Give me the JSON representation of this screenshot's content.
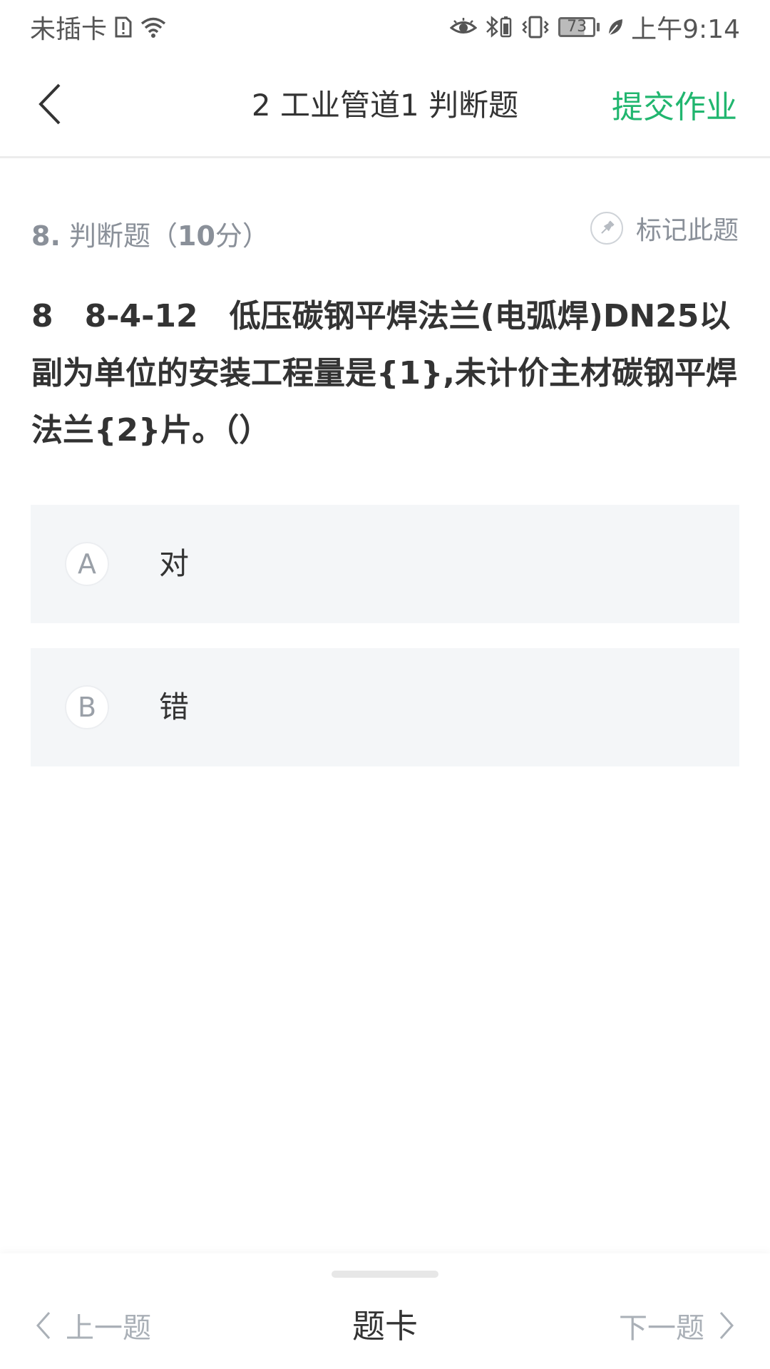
{
  "status_bar": {
    "carrier": "未插卡",
    "battery_level": "73",
    "time": "上午9:14"
  },
  "header": {
    "title": "2 工业管道1 判断题",
    "submit_label": "提交作业"
  },
  "question": {
    "number": "8.",
    "type_label": "判断题（",
    "score": "10",
    "score_suffix": "分）",
    "mark_label": "标记此题",
    "stem": "8　8-4-12　低压碳钢平焊法兰(电弧焊)DN25以副为单位的安装工程量是{1},未计价主材碳钢平焊法兰{2}片。（）",
    "options": [
      {
        "letter": "A",
        "text": "对"
      },
      {
        "letter": "B",
        "text": "错"
      }
    ]
  },
  "bottom_bar": {
    "prev_label": "上一题",
    "card_label": "题卡",
    "next_label": "下一题"
  },
  "colors": {
    "accent": "#21b66f",
    "muted": "#8a9099",
    "option_bg": "#f4f6f8"
  },
  "icons": {
    "back": "chevron-left-icon",
    "mark": "pin-icon",
    "prev": "chevron-left-icon",
    "next": "chevron-right-icon"
  }
}
